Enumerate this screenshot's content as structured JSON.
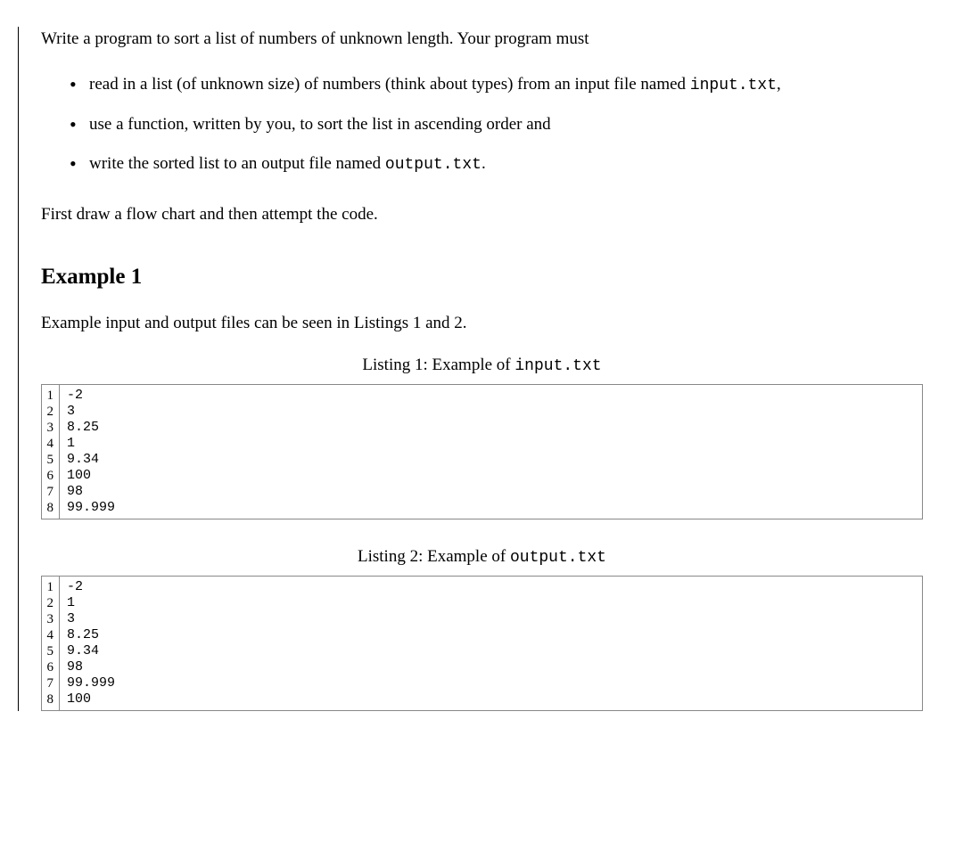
{
  "intro": "Write a program to sort a list of numbers of unknown length. Your program must",
  "bullets": [
    {
      "pre": "read in a list (of unknown size) of numbers (think about types) from an input file named ",
      "code": "input.txt",
      "post": ","
    },
    {
      "pre": "use a function, written by you, to sort the list in ascending order and",
      "code": "",
      "post": ""
    },
    {
      "pre": "write the sorted list to an output file named ",
      "code": "output.txt",
      "post": "."
    }
  ],
  "flow_note": "First draw a flow chart and then attempt the code.",
  "section_heading": "Example 1",
  "example_desc": "Example input and output files can be seen in Listings 1 and 2.",
  "listing1": {
    "caption_pre": "Listing 1: Example of ",
    "caption_code": "input.txt",
    "lines": [
      "-2",
      "3",
      "8.25",
      "1",
      "9.34",
      "100",
      "98",
      "99.999"
    ]
  },
  "listing2": {
    "caption_pre": "Listing 2: Example of ",
    "caption_code": "output.txt",
    "lines": [
      "-2",
      "1",
      "3",
      "8.25",
      "9.34",
      "98",
      "99.999",
      "100"
    ]
  }
}
